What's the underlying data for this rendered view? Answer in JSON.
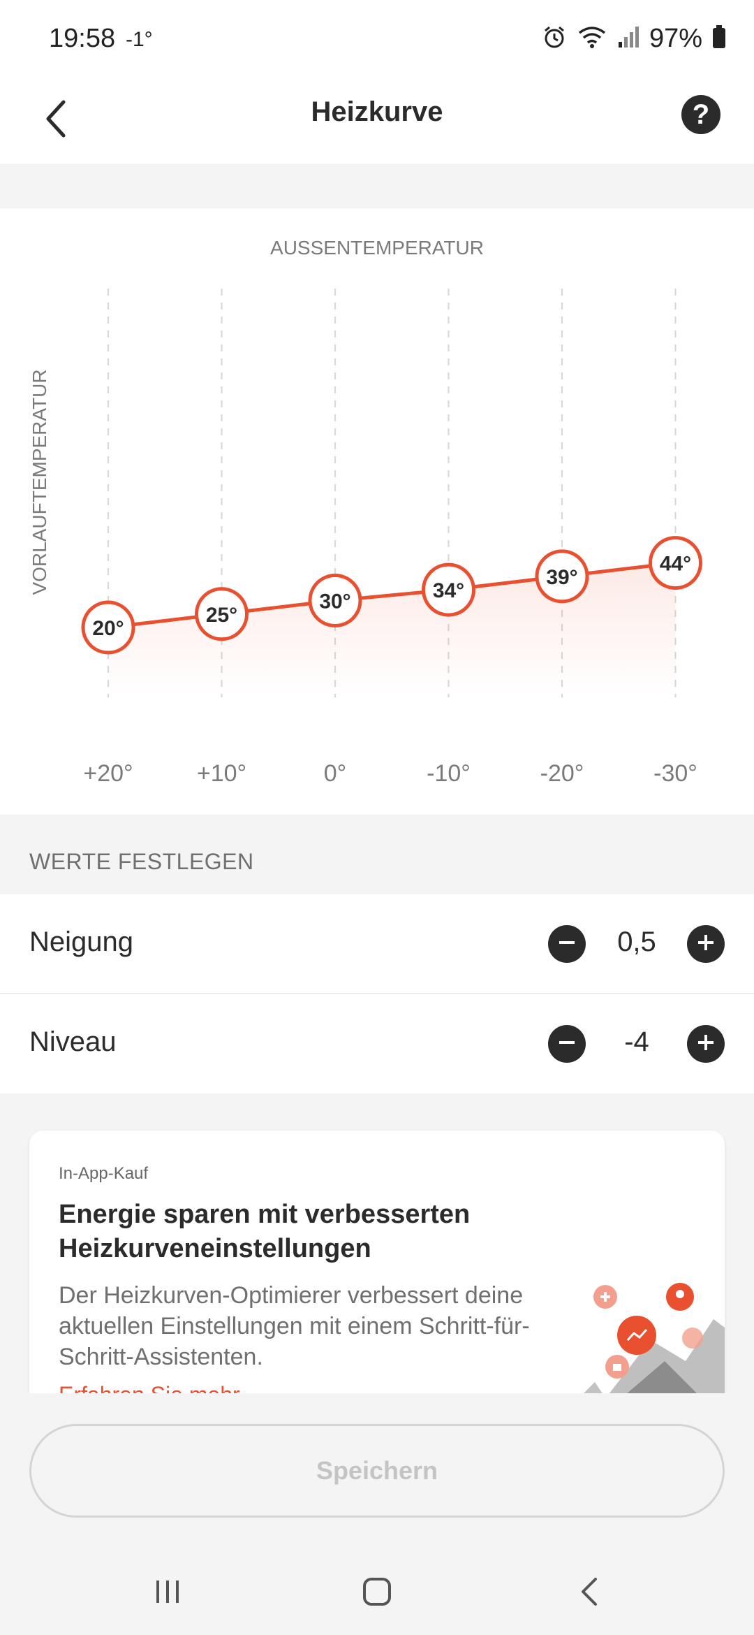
{
  "status_bar": {
    "time": "19:58",
    "temperature": "-1°",
    "battery": "97%",
    "icons": [
      "alarm-icon",
      "wifi-icon",
      "signal-icon",
      "battery-icon"
    ]
  },
  "header": {
    "title": "Heizkurve",
    "back_icon": "chevron-left-icon",
    "help_label": "?"
  },
  "chart_data": {
    "type": "line",
    "title": "AUSSENTEMPERATUR",
    "ylabel": "VORLAUFTEMPERATUR",
    "x": [
      "+20°",
      "+10°",
      "0°",
      "-10°",
      "-20°",
      "-30°"
    ],
    "series": [
      {
        "values": [
          20,
          25,
          30,
          34,
          39,
          44
        ]
      }
    ],
    "point_labels": [
      "20°",
      "25°",
      "30°",
      "34°",
      "39°",
      "44°"
    ],
    "line_color": "#e8502f",
    "grid": true
  },
  "settings": {
    "section_title": "WERTE FESTLEGEN",
    "rows": [
      {
        "label": "Neigung",
        "value": "0,5"
      },
      {
        "label": "Niveau",
        "value": "-4"
      }
    ]
  },
  "promo": {
    "tag": "In-App-Kauf",
    "title": "Energie sparen mit verbesserten Heizkurveneinstellungen",
    "body": "Der Heizkurven-Optimierer verbessert deine aktuellen Einstellungen mit einem Schritt-für-Schritt-Assistenten.",
    "link": "Erfahren Sie mehr"
  },
  "footer": {
    "save_label": "Speichern"
  },
  "navigation": {
    "icons": [
      "recent-apps-icon",
      "home-icon",
      "back-icon"
    ]
  },
  "colors": {
    "accent": "#e8502f",
    "dark": "#2b2b2b",
    "muted": "#6f6f6f"
  }
}
